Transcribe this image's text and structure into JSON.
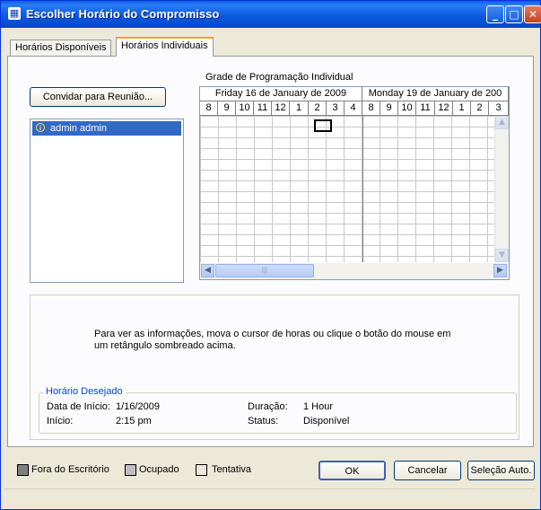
{
  "window": {
    "title": "Escolher Horário do Compromisso",
    "icon": "calendar-icon"
  },
  "tabs": [
    {
      "label": "Horários Disponíveis",
      "active": false
    },
    {
      "label": "Horários Individuais",
      "active": true
    }
  ],
  "invite_button": {
    "label": "Convidar para Reunião..."
  },
  "attendees": [
    {
      "name": "admin admin",
      "icon": "info-icon"
    }
  ],
  "grid": {
    "label": "Grade de Programação Individual",
    "days": [
      "Friday 16 de January de 2009",
      "Monday 19 de January de 200"
    ],
    "hours_day1": [
      "8",
      "9",
      "10",
      "11",
      "12",
      "1",
      "2",
      "3",
      "4"
    ],
    "hours_day2": [
      "8",
      "9",
      "10",
      "11",
      "12",
      "1",
      "2",
      "3"
    ]
  },
  "info_message": "Para ver as informações, mova o cursor de horas ou clique o botão do mouse em um retângulo sombreado acima.",
  "desired_time": {
    "legend": "Horário Desejado",
    "start_date_label": "Data de Início:",
    "start_date_value": "1/16/2009",
    "start_label": "Início:",
    "start_value": "2:15 pm",
    "duration_label": "Duração:",
    "duration_value": "1 Hour",
    "status_label": "Status:",
    "status_value": "Disponível"
  },
  "legend": [
    {
      "label": "Fora do Escritório",
      "color": "#808080"
    },
    {
      "label": "Ocupado",
      "color": "#c0c0c0"
    },
    {
      "label": "Tentativa",
      "color": "#ece9d8"
    }
  ],
  "buttons": {
    "ok": "OK",
    "cancel": "Cancelar",
    "auto": "Seleção Auto."
  },
  "colors": {
    "titlebar": "#0a5fe0",
    "selection": "#316ac5",
    "group_legend": "#0046d5"
  }
}
